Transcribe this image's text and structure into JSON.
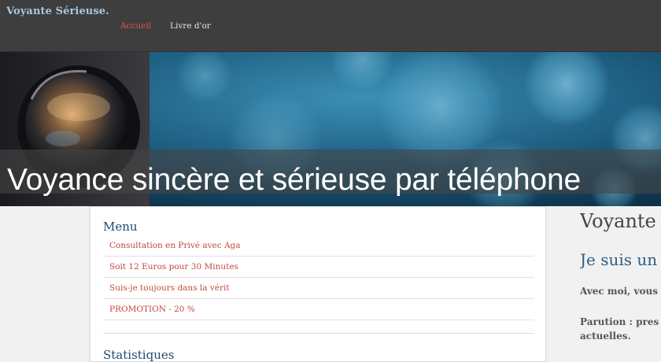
{
  "header": {
    "site_title": "Voyante Sérieuse.",
    "nav": [
      {
        "label": "Accueil",
        "active": true
      },
      {
        "label": "Livre d'or",
        "active": false
      }
    ]
  },
  "banner": {
    "caption": "Voyance sincère et sérieuse par téléphone"
  },
  "sidebar": {
    "menu_title": "Menu",
    "menu_items": [
      "Consultation en Privé avec Aga",
      "Soit 12 Euros pour 30 Minutes",
      "Suis-je toujours dans la vérit",
      "PROMOTION - 20 %"
    ],
    "stats_title": "Statistiques"
  },
  "content": {
    "heading": "Voyante",
    "subheading": "Je suis un",
    "paragraph_1": "Avec moi, vous",
    "paragraph_2_line1": "Parution : pres",
    "paragraph_2_line2": "actuelles."
  },
  "colors": {
    "topbar_bg": "#3e3e3e",
    "site_title": "#a8c8e0",
    "nav_active": "#e05a4e",
    "menu_link": "#c4473c",
    "heading_blue": "#234a6b"
  }
}
